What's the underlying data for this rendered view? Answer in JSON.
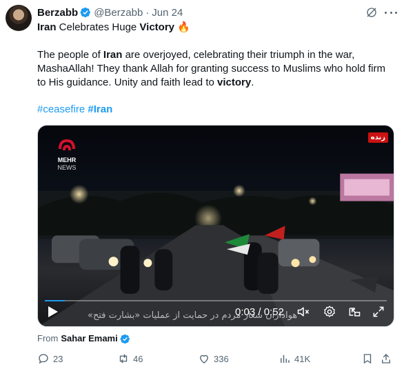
{
  "post": {
    "author_name": "Berzabb",
    "handle": "@Berzabb",
    "separator": "·",
    "date": "Jun 24",
    "title_prefix_bold": "Iran",
    "title_mid": " Celebrates Huge ",
    "title_suffix_bold": "Victory",
    "title_emoji": "🔥",
    "body_1": "The people of ",
    "body_2_bold": "Iran",
    "body_3": " are overjoyed, celebrating their triumph in the war, MashaAllah! They thank Allah for granting success to Muslims who hold firm to His guidance. Unity and faith lead to ",
    "body_4_bold": "victory",
    "body_5": ".",
    "hashtags": [
      "#ceasefire",
      "#Iran"
    ]
  },
  "video": {
    "logo_text_1": "MEHR",
    "logo_text_2": "NEWS",
    "live_badge": "زنده",
    "subtitle": "هواداران شعار مردم در حمایت از عملیات «بشارت فتح»",
    "time_display": "0:03 / 0:52",
    "progress": 0.058
  },
  "attribution": {
    "prefix": "From",
    "source": "Sahar Emami"
  },
  "actions": {
    "replies": "23",
    "reposts": "46",
    "likes": "336",
    "views": "41K"
  },
  "colors": {
    "accent": "#1d9bf0",
    "muted": "#536471",
    "text": "#0f1419",
    "live_red": "#cc1212"
  },
  "icons": [
    "verified-badge-icon",
    "grok-icon",
    "more-icon",
    "play-icon",
    "volume-muted-icon",
    "settings-icon",
    "pip-icon",
    "fullscreen-icon",
    "reply-icon",
    "repost-icon",
    "like-icon",
    "views-icon",
    "bookmark-icon",
    "share-icon"
  ]
}
